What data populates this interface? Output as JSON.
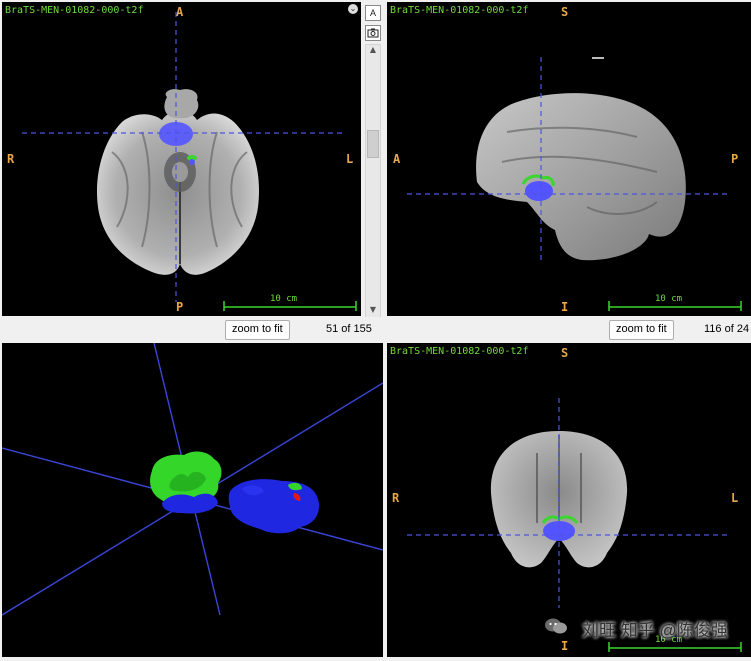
{
  "colors": {
    "label_green": "#6fdc3a",
    "orient_orange": "#e7a64a",
    "crosshair_blue": "#4b55e0",
    "tumor_blue": "#4c4cff",
    "tumor_green": "#3bd62e",
    "tumor_red": "#e01818"
  },
  "axial": {
    "scan_label": "BraTS-MEN-01082-000-t2f",
    "orient_top": "A",
    "orient_bottom": "P",
    "orient_left": "R",
    "orient_right": "L",
    "scale_label": "10 cm",
    "zoom_label": "zoom to fit",
    "slice_count": "51 of 155"
  },
  "sagittal": {
    "scan_label": "BraTS-MEN-01082-000-t2f",
    "orient_top": "S",
    "orient_bottom": "I",
    "orient_left": "A",
    "orient_right": "P",
    "scale_label": "10 cm",
    "zoom_label": "zoom to fit",
    "slice_count": "116 of 24"
  },
  "render3d": {},
  "coronal": {
    "scan_label": "BraTS-MEN-01082-000-t2f",
    "orient_top": "S",
    "orient_bottom": "I",
    "orient_left": "R",
    "orient_right": "L",
    "scale_label": "10 cm"
  },
  "toolstrip": {
    "annotation_icon": "A",
    "camera_icon": "camera-icon"
  },
  "watermark": {
    "text": "刘旺 知乎 @陈俊强",
    "icon": "wechat-icon"
  }
}
